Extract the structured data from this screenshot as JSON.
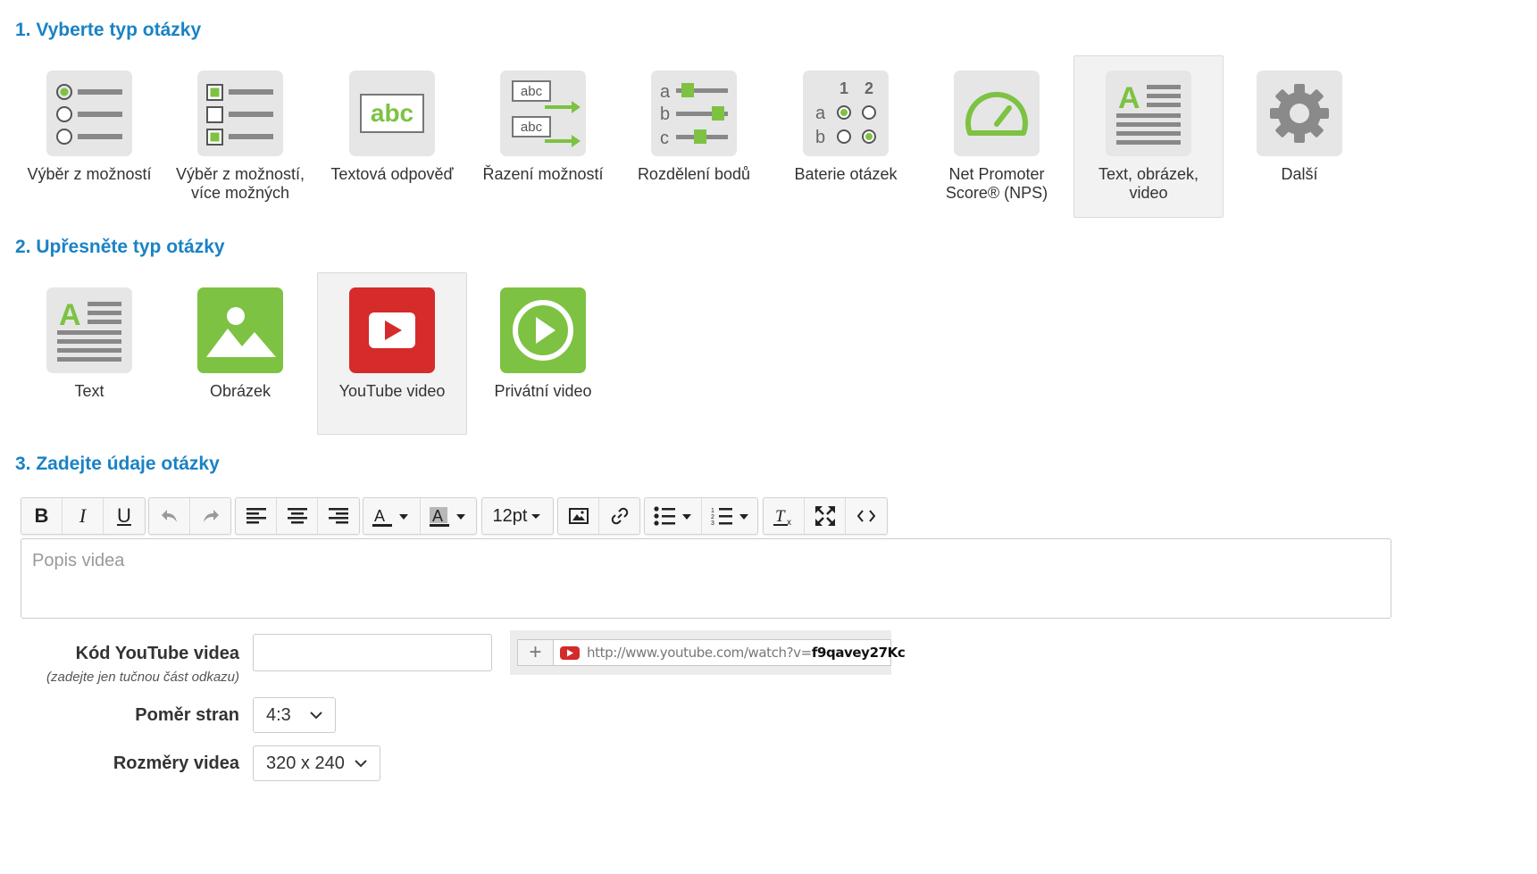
{
  "section1": {
    "title": "1. Vyberte typ otázky",
    "tiles": [
      {
        "label": "Výběr z možností",
        "icon": "single-choice-icon"
      },
      {
        "label": "Výběr z možností, více možných",
        "icon": "multiple-choice-icon"
      },
      {
        "label": "Textová odpověď",
        "icon": "text-answer-icon"
      },
      {
        "label": "Řazení možností",
        "icon": "ranking-icon",
        "icon_text": "abc"
      },
      {
        "label": "Rozdělení bodů",
        "icon": "point-distribution-icon",
        "icon_letters": [
          "a",
          "b",
          "c"
        ]
      },
      {
        "label": "Baterie otázek",
        "icon": "question-battery-icon",
        "icon_cols": [
          "1",
          "2"
        ],
        "icon_rows": [
          "a",
          "b"
        ]
      },
      {
        "label": "Net Promoter Score® (NPS)",
        "icon": "gauge-icon"
      },
      {
        "label": "Text, obrázek, video",
        "icon": "text-image-video-icon",
        "selected": true
      },
      {
        "label": "Další",
        "icon": "gear-icon"
      }
    ],
    "text_answer_icon_text": "abc"
  },
  "section2": {
    "title": "2. Upřesněte typ otázky",
    "tiles": [
      {
        "label": "Text",
        "icon": "text-icon"
      },
      {
        "label": "Obrázek",
        "icon": "image-icon"
      },
      {
        "label": "YouTube video",
        "icon": "youtube-icon",
        "selected": true
      },
      {
        "label": "Privátní video",
        "icon": "private-video-icon"
      }
    ]
  },
  "section3": {
    "title": "3. Zadejte údaje otázky",
    "toolbar": {
      "font_size": "12pt",
      "buttons": [
        "bold-icon",
        "italic-icon",
        "underline-icon",
        "undo-icon",
        "redo-icon",
        "align-left-icon",
        "align-center-icon",
        "align-right-icon",
        "text-color-icon",
        "background-color-icon",
        "font-size",
        "insert-image-icon",
        "link-icon",
        "bullet-list-icon",
        "numbered-list-icon",
        "clear-format-icon",
        "fullscreen-icon",
        "source-code-icon"
      ]
    },
    "editor_placeholder": "Popis videa",
    "youtube_code": {
      "label": "Kód YouTube videa",
      "hint": "(zadejte jen tučnou část odkazu)",
      "value": "",
      "example_url_prefix": "http://www.youtube.com/watch?v=",
      "example_url_code": "f9qavey27Kc"
    },
    "aspect_ratio": {
      "label": "Poměr stran",
      "value": "4:3"
    },
    "video_size": {
      "label": "Rozměry videa",
      "value": "320 x 240"
    }
  },
  "colors": {
    "accent": "#1a82c5",
    "green": "#7dc242",
    "youtube_red": "#d52b2b",
    "icon_gray": "#e6e6e6"
  }
}
